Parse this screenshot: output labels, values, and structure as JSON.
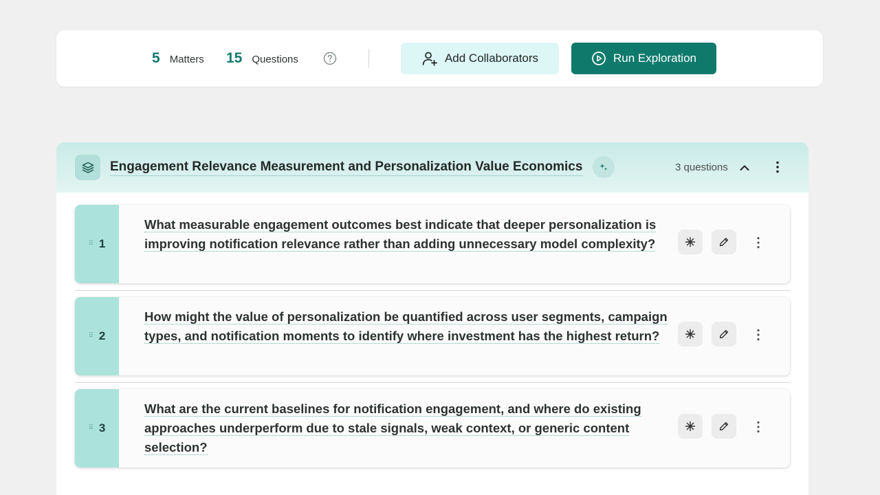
{
  "summary": {
    "matters_count": "5",
    "matters_label": "Matters",
    "questions_count": "15",
    "questions_label": "Questions",
    "add_collaborators_label": "Add Collaborators",
    "run_exploration_label": "Run Exploration"
  },
  "matter": {
    "title": "Engagement Relevance Measurement and Personalization Value Economics",
    "question_count_label": "3 questions",
    "questions": [
      {
        "number": "1",
        "text": "What measurable engagement outcomes best indicate that deeper personalization is improving notification relevance rather than adding unnecessary model complexity?"
      },
      {
        "number": "2",
        "text": "How might the value of personalization be quantified across user segments, campaign types, and notification moments to identify where investment has the highest return?"
      },
      {
        "number": "3",
        "text": "What are the current baselines for notification engagement, and where do existing approaches underperform due to stale signals, weak context, or generic content selection?"
      }
    ]
  },
  "colors": {
    "accent": "#0f7a6c",
    "accent_light": "#ddf6f6",
    "number_column": "#abe2dc",
    "stat_number": "#137a6e"
  },
  "icons": {
    "help": "question-circle-icon",
    "add_user": "add-user-icon",
    "run": "play-circle-icon",
    "layers": "layers-icon",
    "ai": "ai-sparkle-badge-icon",
    "collapse": "chevron-up-icon",
    "more": "kebab-menu-icon",
    "spark": "sparkle-icon",
    "edit": "pencil-icon",
    "drag": "drag-handle-icon"
  }
}
